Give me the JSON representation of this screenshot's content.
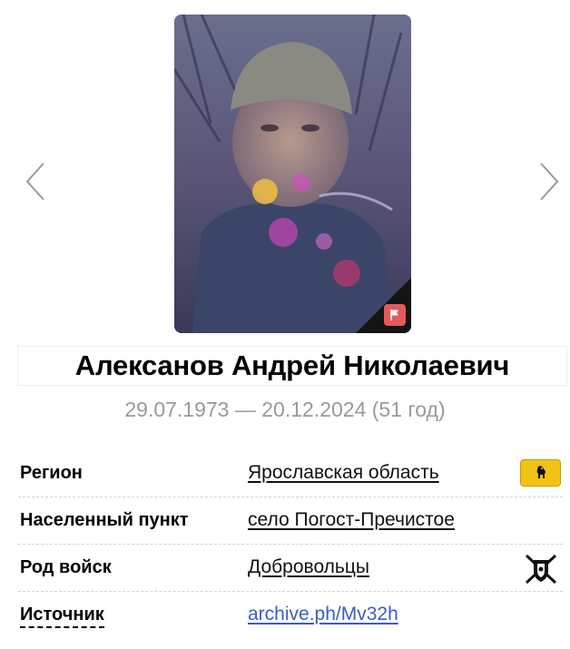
{
  "person": {
    "name": "Алексанов Андрей Николаевич",
    "dates": "29.07.1973 — 20.12.2024 (51 год)"
  },
  "photo": {
    "prev_icon": "chevron-left-icon",
    "next_icon": "chevron-right-icon",
    "flag_icon": "flag-icon",
    "flag_color": "#e35a5a"
  },
  "info": {
    "region_label": "Регион",
    "region_value": "Ярославская область",
    "region_badge_icon": "yaroslavl-coat-of-arms-icon",
    "settlement_label": "Населенный пункт",
    "settlement_value": "село Погост-Пречистое",
    "troops_label": "Род войск",
    "troops_value": "Добровольцы",
    "troops_icon": "volunteers-emblem-icon",
    "source_label": "Источник",
    "source_value": "archive.ph/Mv32h"
  },
  "colors": {
    "link": "#3a5cc9",
    "dates": "#9a9a9a",
    "badge": "#f2c314"
  }
}
